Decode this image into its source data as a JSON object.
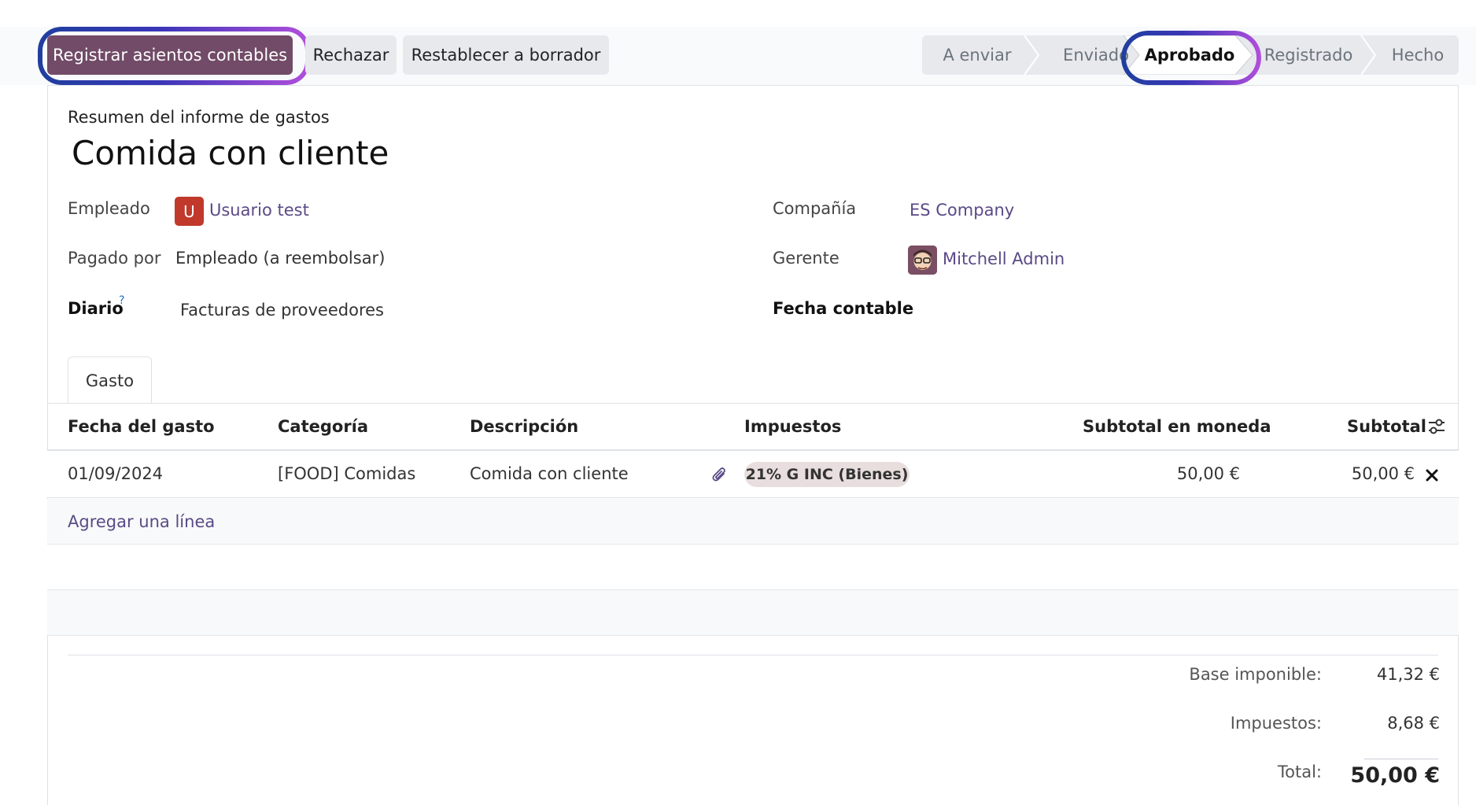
{
  "actions": {
    "post_entries": "Registrar asientos contables",
    "refuse": "Rechazar",
    "reset_draft": "Restablecer a borrador"
  },
  "status": {
    "stages": [
      "A enviar",
      "Enviado",
      "Aprobado",
      "Registrado",
      "Hecho"
    ],
    "active": "Aprobado"
  },
  "report": {
    "subtitle": "Resumen del informe de gastos",
    "title": "Comida con cliente"
  },
  "fields": {
    "employee_label": "Empleado",
    "employee_initial": "U",
    "employee_value": "Usuario test",
    "paid_by_label": "Pagado por",
    "paid_by_value": "Empleado (a reembolsar)",
    "journal_label": "Diario",
    "journal_help": "?",
    "journal_value": "Facturas de proveedores",
    "company_label": "Compañía",
    "company_value": "ES Company",
    "manager_label": "Gerente",
    "manager_value": "Mitchell Admin",
    "accounting_date_label": "Fecha contable"
  },
  "tabs": [
    "Gasto"
  ],
  "table": {
    "headers": {
      "date": "Fecha del gasto",
      "category": "Categoría",
      "description": "Descripción",
      "taxes": "Impuestos",
      "subtotal_currency": "Subtotal en moneda",
      "subtotal": "Subtotal"
    },
    "rows": [
      {
        "date": "01/09/2024",
        "category": "[FOOD] Comidas",
        "description": "Comida con cliente",
        "tax": "21% G INC (Bienes)",
        "subtotal_currency": "50,00 €",
        "subtotal": "50,00 €"
      }
    ],
    "add_line": "Agregar una línea"
  },
  "totals": {
    "base_label": "Base imponible:",
    "base_value": "41,32 €",
    "tax_label": "Impuestos:",
    "tax_value": "8,68 €",
    "total_label": "Total:",
    "total_value": "50,00 €"
  },
  "colors": {
    "primary": "#714b67",
    "link": "#5a4a86",
    "avatar_bg": "#c0392b",
    "highlight_ring_start": "#1f3f9e",
    "highlight_ring_end": "#b24fdc"
  },
  "icons": {
    "attachment": "paperclip-icon",
    "column_settings": "sliders-icon",
    "delete": "close-icon"
  }
}
